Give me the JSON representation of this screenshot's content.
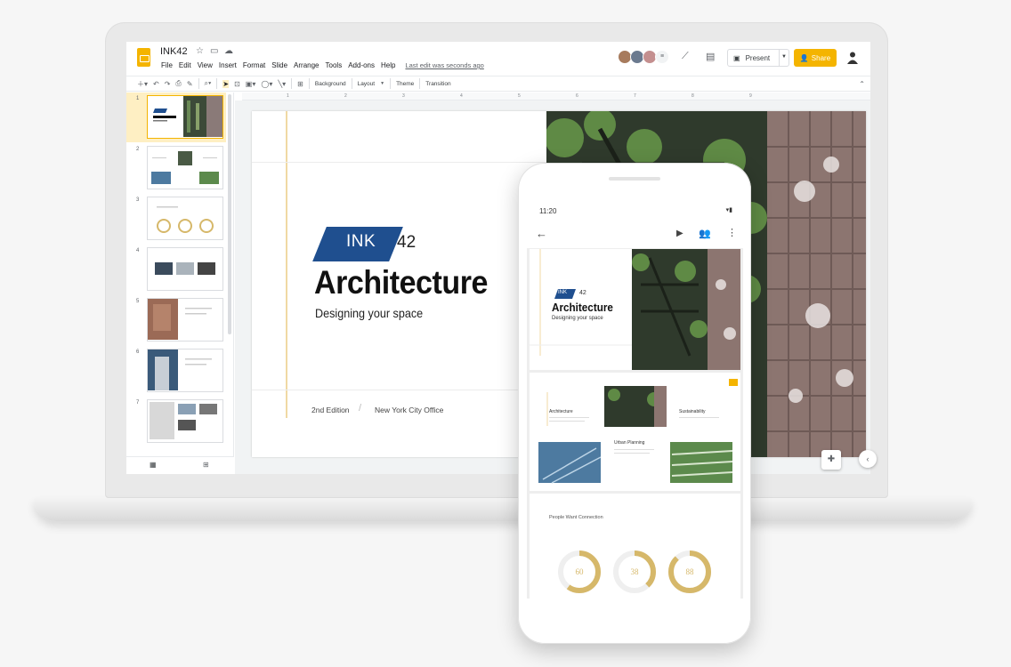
{
  "app": {
    "title": "INK42",
    "menus": [
      "File",
      "Edit",
      "View",
      "Insert",
      "Format",
      "Slide",
      "Arrange",
      "Tools",
      "Add-ons",
      "Help"
    ],
    "last_edit": "Last edit was seconds ago",
    "present_label": "Present",
    "share_label": "Share",
    "colors": {
      "accent": "#f4b400",
      "brand_blue": "#1f4f8f",
      "gold_ring": "#d6b86a"
    }
  },
  "toolbar": {
    "background_label": "Background",
    "layout_label": "Layout",
    "theme_label": "Theme",
    "transition_label": "Transition"
  },
  "ruler": {
    "numbers": [
      "1",
      "2",
      "3",
      "4",
      "5",
      "6",
      "7",
      "8",
      "9"
    ]
  },
  "filmstrip": {
    "slide_numbers": [
      "1",
      "2",
      "3",
      "4",
      "5",
      "6",
      "7"
    ]
  },
  "slide": {
    "logo_text": "INK",
    "logo_number": "42",
    "heading": "Architecture",
    "subheading": "Designing your space",
    "edition": "2nd Edition",
    "separator": "/",
    "office": "New York City Office"
  },
  "phone": {
    "time": "11:20",
    "slide1": {
      "logo_text": "INK",
      "logo_number": "42",
      "heading": "Architecture",
      "subheading": "Designing your space"
    },
    "slide2": {
      "col1": "Architecture",
      "col2": "Urban Planning",
      "col3": "Sustainability"
    },
    "slide3": {
      "heading": "People Want Connection",
      "rings": [
        {
          "label": "60",
          "value": 0.6
        },
        {
          "label": "38",
          "value": 0.38
        },
        {
          "label": "88",
          "value": 0.88
        }
      ]
    }
  }
}
